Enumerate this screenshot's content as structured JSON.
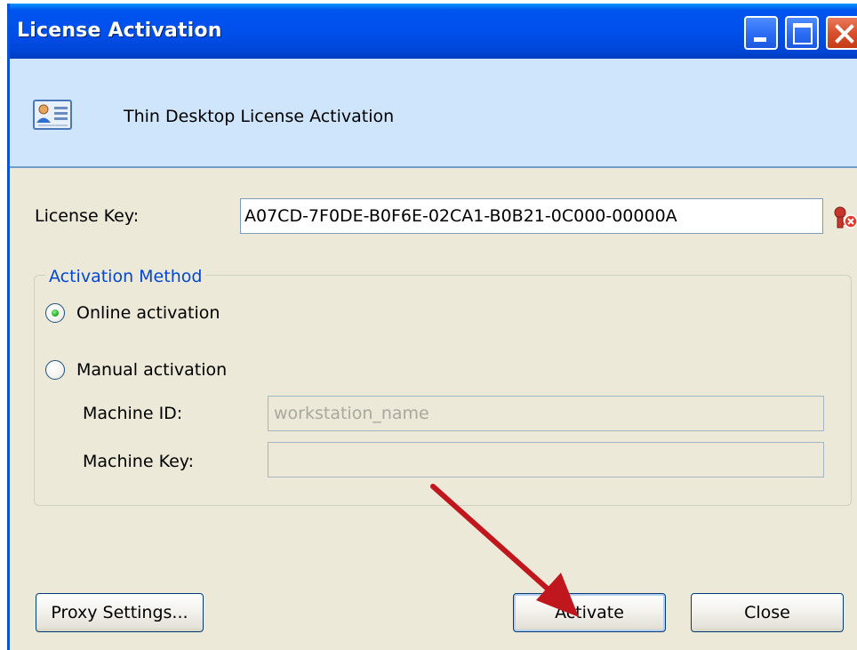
{
  "window": {
    "title": "License Activation"
  },
  "header": {
    "text": "Thin Desktop License Activation",
    "icon": "license-card-icon"
  },
  "license": {
    "label": "License Key:",
    "value": "A07CD-7F0DE-B0F6E-02CA1-B0B21-0C000-00000A",
    "status_icon": "invalid-key-icon"
  },
  "activation": {
    "legend": "Activation Method",
    "online_label": "Online activation",
    "manual_label": "Manual activation",
    "selected": "online",
    "machine_id_label": "Machine ID:",
    "machine_id_value": "workstation_name",
    "machine_key_label": "Machine Key:",
    "machine_key_value": ""
  },
  "buttons": {
    "proxy": "Proxy Settings...",
    "activate": "Activate",
    "close": "Close"
  },
  "colors": {
    "titlebar": "#0050ee",
    "header_panel": "#cfe5fb",
    "dialog_bg": "#ece9d8",
    "legend_text": "#0046d5",
    "annotation_arrow": "#c0161e"
  }
}
